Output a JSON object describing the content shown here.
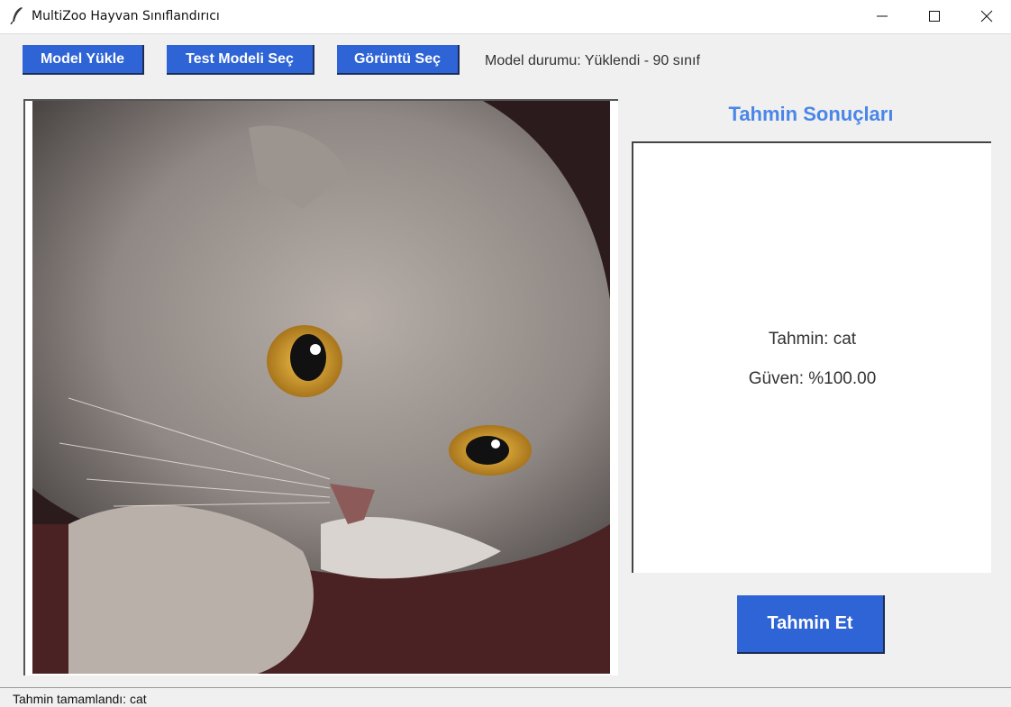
{
  "window": {
    "title": "MultiZoo Hayvan Sınıflandırıcı",
    "app_icon": "feather-icon",
    "controls": [
      "minimize-icon",
      "maximize-icon",
      "close-icon"
    ]
  },
  "toolbar": {
    "load_model_label": "Model Yükle",
    "test_model_label": "Test Modeli Seç",
    "select_image_label": "Görüntü Seç",
    "model_status": "Model durumu: Yüklendi - 90 sınıf"
  },
  "results": {
    "title": "Tahmin Sonuçları",
    "prediction": "Tahmin: cat",
    "confidence": "Güven: %100.00"
  },
  "predict_button_label": "Tahmin Et",
  "statusbar": {
    "text": "Tahmin tamamlandı: cat"
  },
  "colors": {
    "button_bg": "#2f64d6",
    "results_title": "#4a86e8",
    "window_bg": "#f0f0f0"
  }
}
